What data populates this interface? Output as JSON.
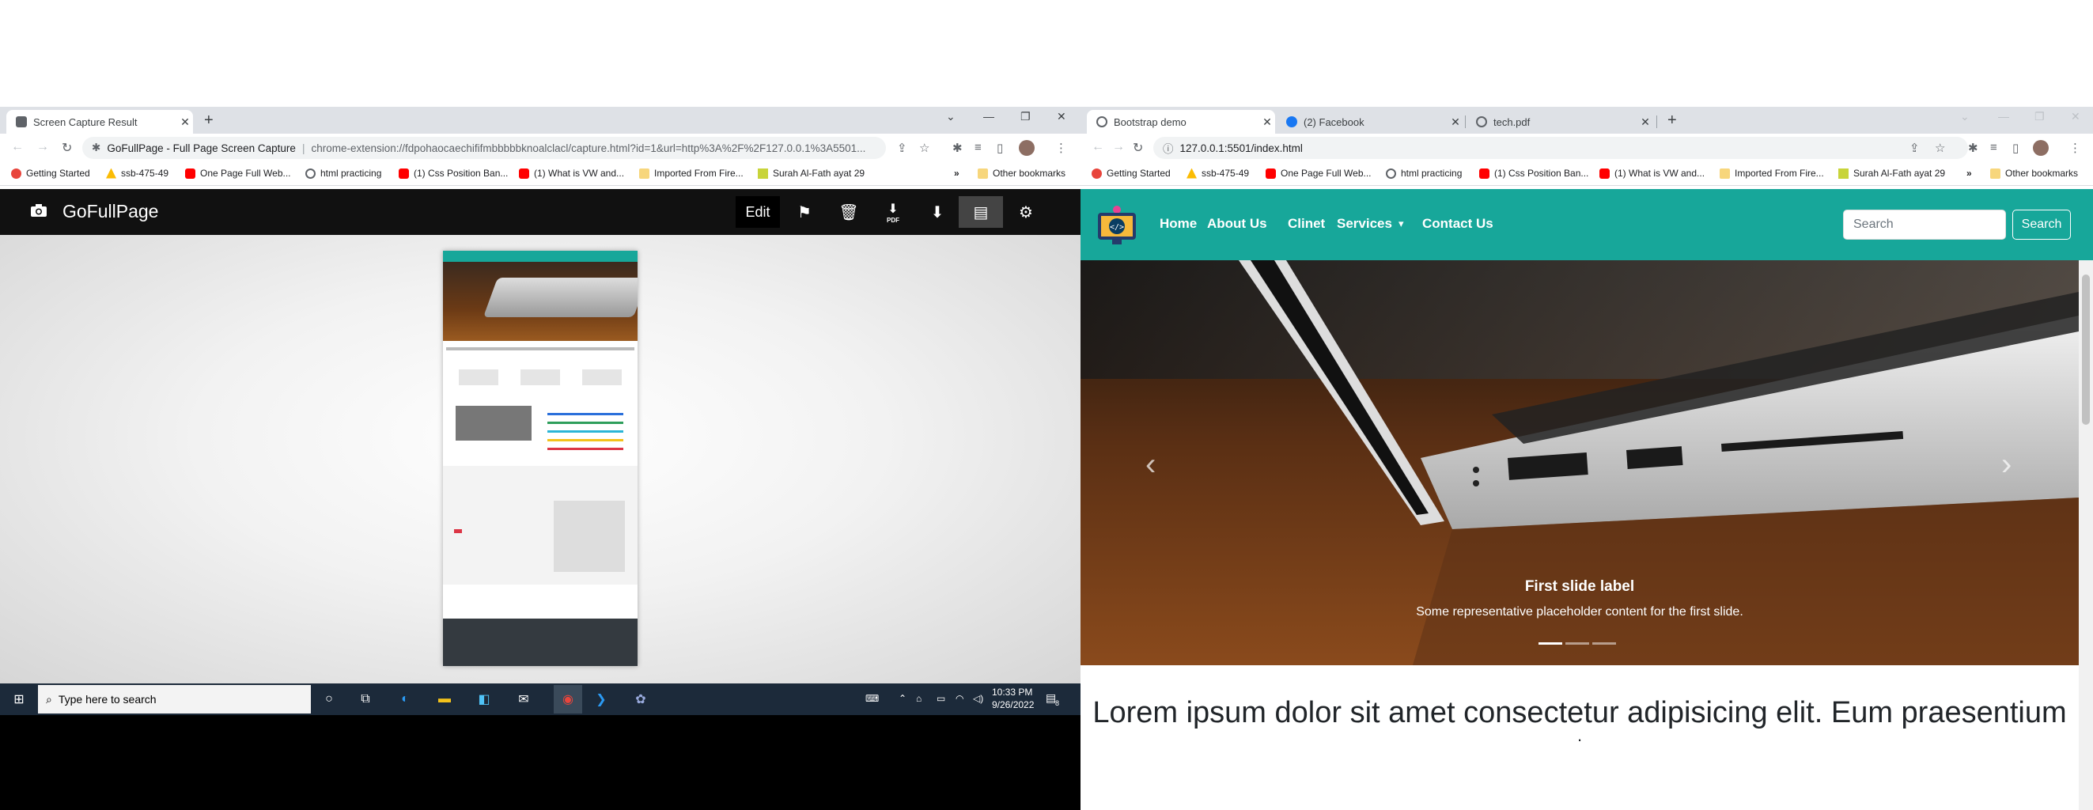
{
  "left_browser": {
    "tabs": [
      {
        "title": "Screen Capture Result",
        "active": true
      }
    ],
    "address_prefix": "GoFullPage - Full Page Screen Capture",
    "address_url": "chrome-extension://fdpohaocaechififmbbbbbknoalclacl/capture.html?id=1&url=http%3A%2F%2F127.0.0.1%3A5501...",
    "bookmarks": [
      "Getting Started",
      "ssb-475-49",
      "One Page Full Web...",
      "html practicing",
      "(1) Css Position Ban...",
      "(1) What is VW and...",
      "Imported From Fire...",
      "Surah Al-Fath ayat 29"
    ],
    "bookmarks_more": "»",
    "other_bookmarks": "Other bookmarks"
  },
  "right_browser": {
    "tabs": [
      {
        "title": "Bootstrap demo",
        "active": true
      },
      {
        "title": "(2) Facebook",
        "active": false
      },
      {
        "title": "tech.pdf",
        "active": false
      }
    ],
    "address_url": "127.0.0.1:5501/index.html",
    "bookmarks": [
      "Getting Started",
      "ssb-475-49",
      "One Page Full Web...",
      "html practicing",
      "(1) Css Position Ban...",
      "(1) What is VW and...",
      "Imported From Fire...",
      "Surah Al-Fath ayat 29"
    ],
    "bookmarks_more": "»",
    "other_bookmarks": "Other bookmarks"
  },
  "gofullpage": {
    "title": "GoFullPage",
    "edit_label": "Edit",
    "pdf_label": "PDF",
    "tools": [
      "flag-icon",
      "trash-icon",
      "download-pdf-icon",
      "download-icon",
      "document-icon",
      "gear-icon"
    ]
  },
  "taskbar": {
    "search_placeholder": "Type here to search",
    "time": "10:33 PM",
    "date": "9/26/2022",
    "notification_count": "8"
  },
  "site": {
    "nav": [
      "Home",
      "About Us",
      "Clinet",
      "Services",
      "Contact Us"
    ],
    "services_caret": "▾",
    "search_placeholder": "Search",
    "search_button": "Search",
    "carousel": {
      "caption_title": "First slide label",
      "caption_text": "Some representative placeholder content for the first slide.",
      "indicators": 3,
      "active_indicator": 1
    },
    "lead": "Lorem ipsum dolor sit amet consectetur adipisicing elit. Eum praesentium",
    "lead_dot": "."
  },
  "colors": {
    "teal": "#17a79a",
    "taskbar": "#1c2a3a",
    "gfp_bar": "#111111"
  }
}
